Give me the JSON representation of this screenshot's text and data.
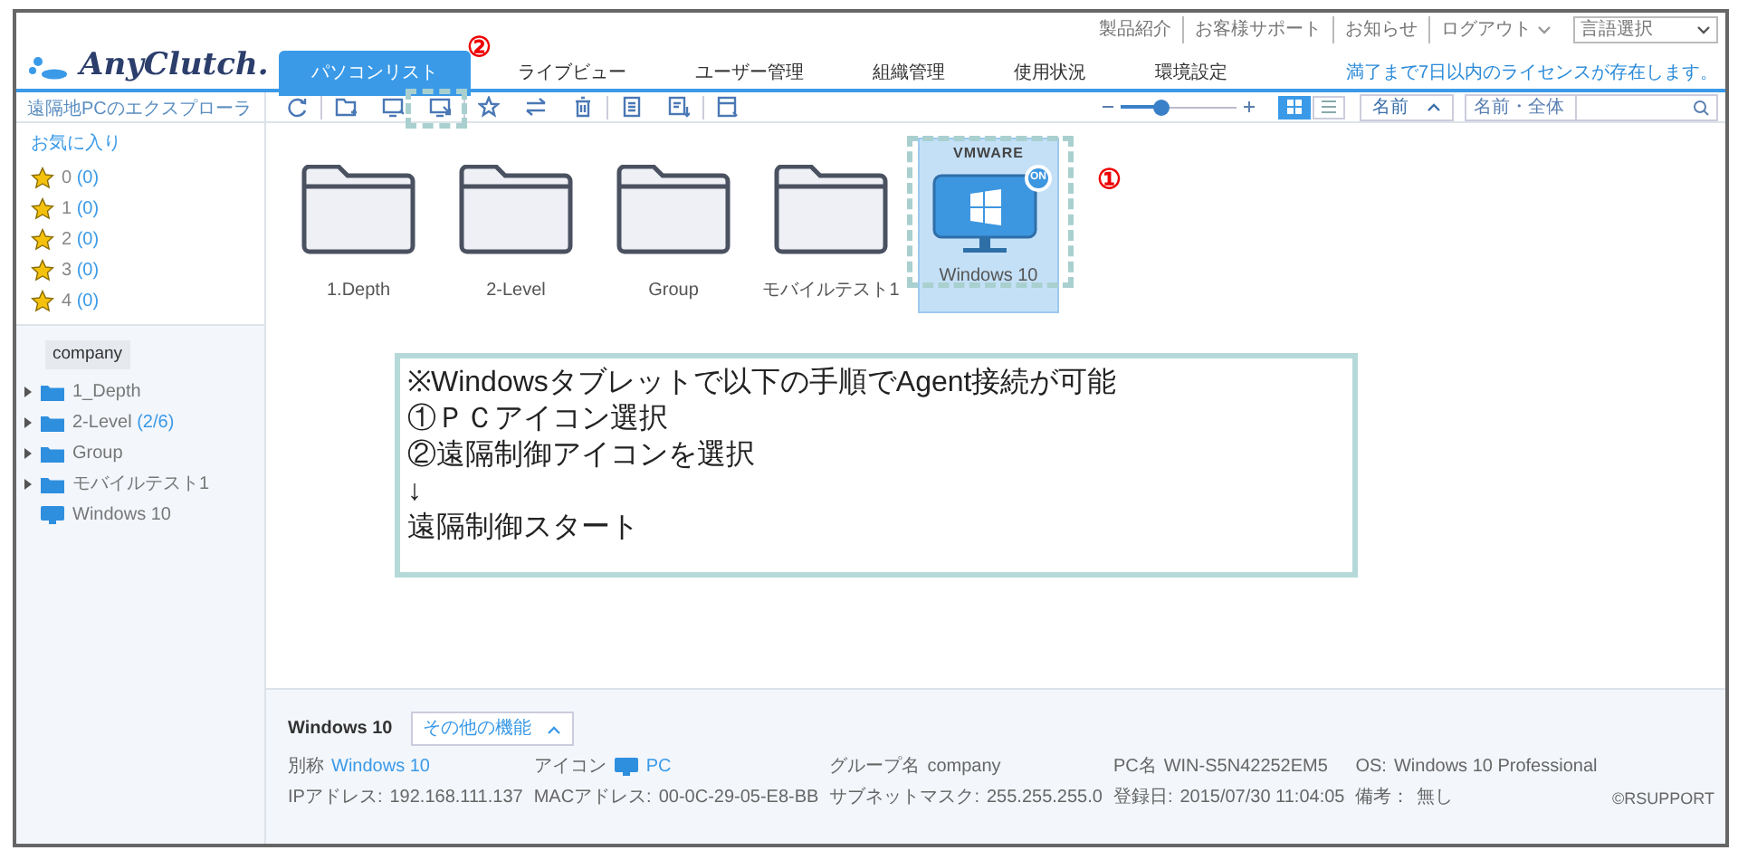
{
  "top_links": [
    {
      "label": "製品紹介"
    },
    {
      "label": "お客様サポート"
    },
    {
      "label": "お知らせ"
    },
    {
      "label": "ログアウト",
      "dropdown": true
    }
  ],
  "language_select": {
    "value": "言語選択"
  },
  "logo": {
    "text": "AnyClutch."
  },
  "tabs": [
    {
      "label": "パソコンリスト",
      "selected": true
    },
    {
      "label": "ライブビュー",
      "selected": false
    },
    {
      "label": "ユーザー管理",
      "selected": false
    },
    {
      "label": "組織管理",
      "selected": false
    },
    {
      "label": "使用状況",
      "selected": false
    },
    {
      "label": "環境設定",
      "selected": false
    }
  ],
  "license_notice": "満了まで7日以内のライセンスが存在します。",
  "sidebar": {
    "title": "遠隔地PCのエクスプローラ",
    "favorites_title": "お気に入り",
    "favorites": [
      {
        "label": "0",
        "count": "(0)"
      },
      {
        "label": "1",
        "count": "(0)"
      },
      {
        "label": "2",
        "count": "(0)"
      },
      {
        "label": "3",
        "count": "(0)"
      },
      {
        "label": "4",
        "count": "(0)"
      }
    ],
    "group_label": "company",
    "tree": [
      {
        "kind": "folder",
        "label": "1_Depth"
      },
      {
        "kind": "folder",
        "label": "2-Level",
        "count": "(2/6)"
      },
      {
        "kind": "folder",
        "label": "Group"
      },
      {
        "kind": "folder",
        "label": "モバイルテスト1"
      },
      {
        "kind": "pc",
        "label": "Windows 10"
      }
    ]
  },
  "toolbar": {
    "zoom": {
      "level": 0.35
    },
    "view_modes": [
      {
        "kind": "grid",
        "selected": true
      },
      {
        "kind": "list",
        "selected": false
      }
    ],
    "sort": {
      "label": "名前"
    },
    "search": {
      "scope": "名前・全体"
    }
  },
  "items": [
    {
      "kind": "folder",
      "label": "1.Depth",
      "selected": false
    },
    {
      "kind": "folder",
      "label": "2-Level",
      "selected": false
    },
    {
      "kind": "folder",
      "label": "Group",
      "selected": false
    },
    {
      "kind": "folder",
      "label": "モバイルテスト1",
      "selected": false
    },
    {
      "kind": "pc",
      "label": "Windows 10",
      "selected": true,
      "vendor": "VMWARE",
      "badge": "ON"
    }
  ],
  "annotations": {
    "markers": [
      {
        "label": "①"
      },
      {
        "label": "②"
      }
    ],
    "callout": [
      "※Windowsタブレットで以下の手順でAgent接続が可能",
      "①ＰＣアイコン選択",
      "②遠隔制御アイコンを選択",
      "↓",
      "遠隔制御スタート"
    ]
  },
  "details": {
    "title": "Windows 10",
    "more_button": "その他の機能",
    "columns": [
      [
        {
          "label": "別称",
          "value": "Windows 10",
          "kind": "link"
        },
        {
          "label": "IPアドレス:",
          "value": "192.168.111.137",
          "kind": "text"
        }
      ],
      [
        {
          "label": "アイコン",
          "value": "PC",
          "kind": "icon_link"
        },
        {
          "label": "MACアドレス:",
          "value": "00-0C-29-05-E8-BB",
          "kind": "text"
        }
      ],
      [
        {
          "label": "グループ名",
          "value": "company",
          "kind": "text"
        },
        {
          "label": "サブネットマスク:",
          "value": "255.255.255.0",
          "kind": "text"
        }
      ],
      [
        {
          "label": "PC名",
          "value": "WIN-S5N42252EM5",
          "kind": "text"
        },
        {
          "label": "登録日:",
          "value": "2015/07/30 11:04:05",
          "kind": "text"
        }
      ],
      [
        {
          "label": "OS:",
          "value": "Windows 10 Professional",
          "kind": "text"
        },
        {
          "label": "備考：",
          "value": "無し",
          "kind": "text"
        }
      ]
    ],
    "copyright": "©RSUPPORT"
  }
}
